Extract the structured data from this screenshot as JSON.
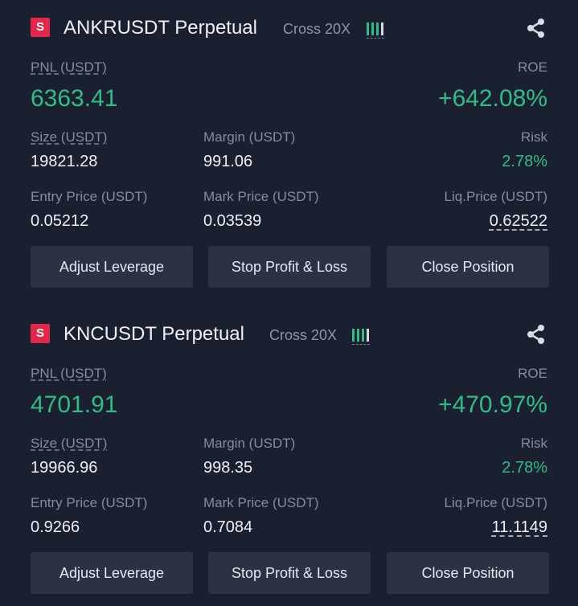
{
  "positions": [
    {
      "side_badge": "S",
      "symbol": "ANKRUSDT Perpetual",
      "margin_mode": "Cross 20X",
      "pnl_label": "PNL (USDT)",
      "pnl_value": "6363.41",
      "roe_label": "ROE",
      "roe_value": "+642.08%",
      "size_label": "Size (USDT)",
      "size_value": "19821.28",
      "margin_label": "Margin (USDT)",
      "margin_value": "991.06",
      "risk_label": "Risk",
      "risk_value": "2.78%",
      "entry_price_label": "Entry Price (USDT)",
      "entry_price_value": "0.05212",
      "mark_price_label": "Mark Price (USDT)",
      "mark_price_value": "0.03539",
      "liq_price_label": "Liq.Price (USDT)",
      "liq_price_value": "0.62522",
      "buttons": [
        "Adjust Leverage",
        "Stop Profit & Loss",
        "Close Position"
      ]
    },
    {
      "side_badge": "S",
      "symbol": "KNCUSDT Perpetual",
      "margin_mode": "Cross 20X",
      "pnl_label": "PNL (USDT)",
      "pnl_value": "4701.91",
      "roe_label": "ROE",
      "roe_value": "+470.97%",
      "size_label": "Size (USDT)",
      "size_value": "19966.96",
      "margin_label": "Margin (USDT)",
      "margin_value": "998.35",
      "risk_label": "Risk",
      "risk_value": "2.78%",
      "entry_price_label": "Entry Price (USDT)",
      "entry_price_value": "0.9266",
      "mark_price_label": "Mark Price (USDT)",
      "mark_price_value": "0.7084",
      "liq_price_label": "Liq.Price (USDT)",
      "liq_price_value": "11.1149",
      "buttons": [
        "Adjust Leverage",
        "Stop Profit & Loss",
        "Close Position"
      ]
    }
  ],
  "icons": {
    "leverage": "leverage-bars-icon",
    "share": "share-icon"
  },
  "colors": {
    "background": "#1b2030",
    "positive": "#2ebd85",
    "short_badge": "#e0294a",
    "button": "#2b3244"
  }
}
